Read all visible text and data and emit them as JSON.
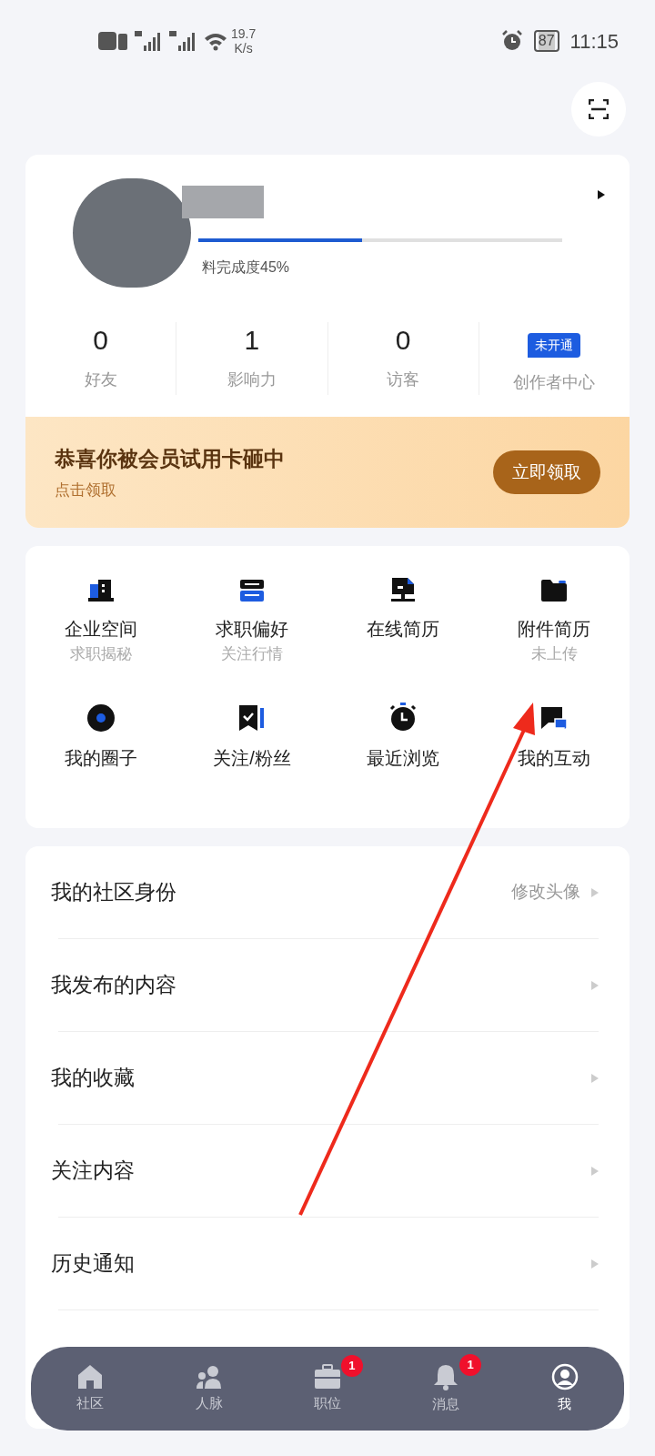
{
  "status_bar": {
    "net_speed": "19.7",
    "net_unit": "K/s",
    "battery": "87",
    "time": "11:15"
  },
  "profile": {
    "completion_text": "料完成度45%",
    "level": 0.45
  },
  "stats": [
    {
      "value": "0",
      "label": "好友",
      "kind": "number"
    },
    {
      "value": "1",
      "label": "影响力",
      "kind": "number"
    },
    {
      "value": "0",
      "label": "访客",
      "kind": "number"
    },
    {
      "value": "未开通",
      "label": "创作者中心",
      "kind": "badge"
    }
  ],
  "banner": {
    "title": "恭喜你被会员试用卡砸中",
    "subtitle": "点击领取",
    "button": "立即领取"
  },
  "shortcuts": [
    {
      "label": "企业空间",
      "sub": "求职揭秘"
    },
    {
      "label": "求职偏好",
      "sub": "关注行情"
    },
    {
      "label": "在线简历"
    },
    {
      "label": "附件简历",
      "sub": "未上传"
    },
    {
      "label": "我的圈子"
    },
    {
      "label": "关注/粉丝"
    },
    {
      "label": "最近浏览"
    },
    {
      "label": "我的互动"
    }
  ],
  "menu": [
    {
      "label": "我的社区身份",
      "hint": "修改头像"
    },
    {
      "label": "我发布的内容"
    },
    {
      "label": "我的收藏"
    },
    {
      "label": "关注内容"
    },
    {
      "label": "历史通知"
    }
  ],
  "nav": [
    {
      "label": "社区",
      "selected": false
    },
    {
      "label": "人脉",
      "selected": false
    },
    {
      "label": "职位",
      "badge": "1",
      "selected": false
    },
    {
      "label": "消息",
      "badge": "1",
      "selected": false
    },
    {
      "label": "我",
      "selected": true
    }
  ]
}
